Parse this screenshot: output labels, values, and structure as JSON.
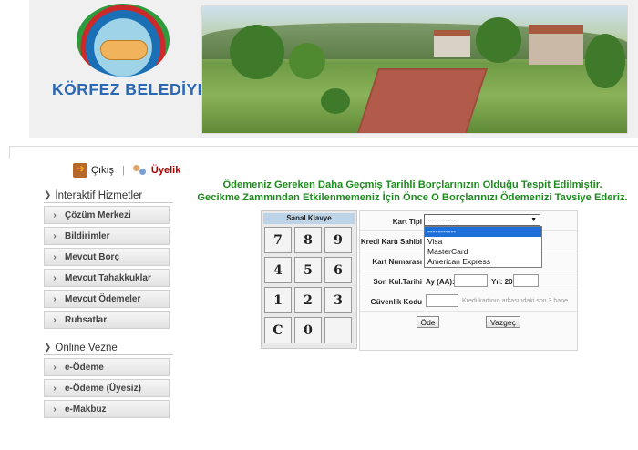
{
  "header": {
    "logo_text": "KÖRFEZ BELEDİYESİ"
  },
  "userbar": {
    "logout_label": "Çıkış",
    "divider": "|",
    "member_label": "Üyelik"
  },
  "sidebar": {
    "sections": [
      {
        "title": "İnteraktif Hizmetler",
        "items": [
          {
            "label": "Çözüm Merkezi"
          },
          {
            "label": "Bildirimler"
          },
          {
            "label": "Mevcut Borç"
          },
          {
            "label": "Mevcut Tahakkuklar"
          },
          {
            "label": "Mevcut Ödemeler"
          },
          {
            "label": "Ruhsatlar"
          }
        ]
      },
      {
        "title": "Online Vezne",
        "items": [
          {
            "label": "e-Ödeme"
          },
          {
            "label": "e-Ödeme (Üyesiz)"
          },
          {
            "label": "e-Makbuz"
          }
        ]
      }
    ]
  },
  "notice": {
    "line1": "Ödemeniz Gereken Daha Geçmiş Tarihli Borçlarınızın Olduğu Tespit Edilmiştir.",
    "line2": "Gecikme Zammından Etkilenmemeniz İçin Önce O Borçlarınızı Ödemenizi Tavsiye Ederiz."
  },
  "keypad": {
    "title": "Sanal Klavye",
    "keys": [
      "7",
      "8",
      "9",
      "4",
      "5",
      "6",
      "1",
      "2",
      "3",
      "C",
      "0",
      ""
    ]
  },
  "form": {
    "card_type_label": "Kart Tipi",
    "card_type_value": "-----------",
    "card_type_options": [
      "-----------",
      "Visa",
      "MasterCard",
      "American Express"
    ],
    "card_holder_label": "Kredi Kartı Sahibi",
    "card_number_label": "Kart Numarası",
    "expiry_label": "Son Kul.Tarihi",
    "month_label": "Ay (AA):",
    "year_label": "Yıl: 20",
    "cvv_label": "Güvenlik Kodu",
    "cvv_hint": "Kredi kartının arkasındaki son 3 hane",
    "pay_button": "Öde",
    "cancel_button": "Vazgeç"
  }
}
